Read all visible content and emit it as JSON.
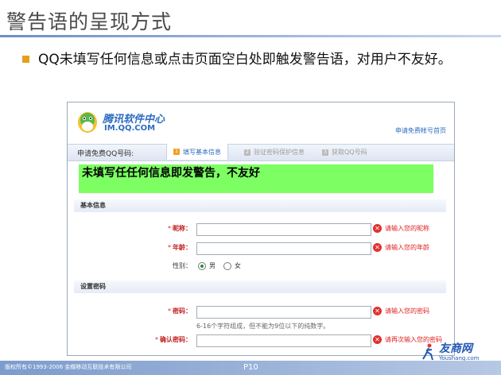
{
  "slide": {
    "title": "警告语的呈现方式",
    "bullet": "QQ未填写任何信息或点击页面空白处即触发警告语，对用户不友好。",
    "page": "P10",
    "copyright": "版权所有©1993-2006 金蝶移动互联技术有限公司"
  },
  "header": {
    "logo_name": "腾讯软件中心",
    "logo_url": "IM.QQ.COM",
    "home_link": "申请免费帐号首页"
  },
  "steps": {
    "label": "申请免费QQ号码:",
    "items": [
      {
        "num": "1",
        "label": "填写基本信息"
      },
      {
        "num": "2",
        "label": "验证密码保护信息"
      },
      {
        "num": "3",
        "label": "获取QQ号码"
      }
    ]
  },
  "warning": "未填写任任何信息即发警告，不友好",
  "basic": {
    "section": "基本信息",
    "nickname_label": "昵称：",
    "nickname_error": "请输入您的昵称",
    "age_label": "年龄：",
    "age_error": "请输入您的年龄",
    "gender_label": "性别：",
    "male": "男",
    "female": "女"
  },
  "password": {
    "section": "设置密码",
    "password_label": "密码：",
    "password_error": "请输入您的密码",
    "hint": "6-16个字符组成，但不能为9位以下的纯数字。",
    "confirm_label": "确认密码：",
    "confirm_error": "请再次输入您的密码"
  },
  "brand": {
    "name": "友商网",
    "domain": "Youshang.com"
  },
  "colors": {
    "accent": "#2d6cc0",
    "warning_bg": "#7dff64",
    "error": "#e02020",
    "bullet": "#e3a21a"
  }
}
